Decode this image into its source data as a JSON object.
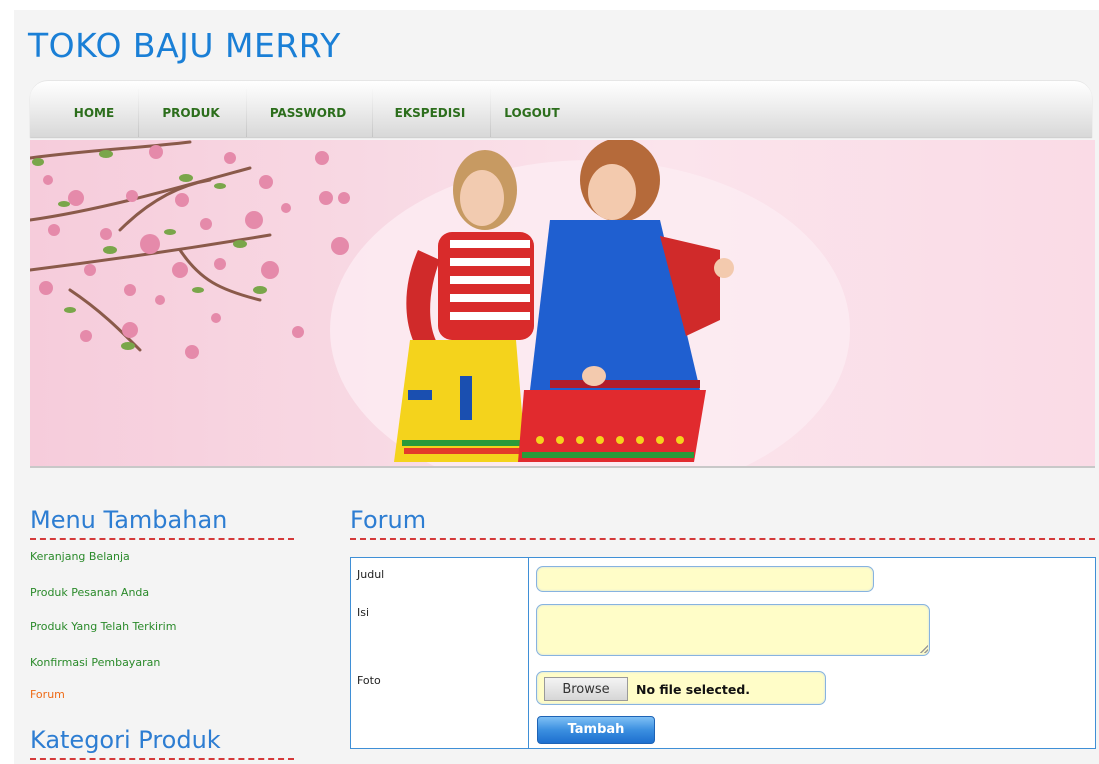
{
  "site": {
    "title": "TOKO BAJU MERRY"
  },
  "nav": {
    "items": [
      {
        "label": "HOME"
      },
      {
        "label": "PRODUK"
      },
      {
        "label": "PASSWORD"
      },
      {
        "label": "EKSPEDISI"
      },
      {
        "label": "LOGOUT"
      }
    ]
  },
  "sidebar": {
    "menu_title": "Menu Tambahan",
    "links": [
      {
        "label": "Keranjang Belanja"
      },
      {
        "label": "Produk Pesanan Anda"
      },
      {
        "label": "Produk Yang Telah Terkirim"
      },
      {
        "label": "Konfirmasi Pembayaran"
      },
      {
        "label": "Forum"
      }
    ],
    "category_title": "Kategori Produk"
  },
  "forum": {
    "title": "Forum",
    "labels": {
      "judul": "Judul",
      "isi": "Isi",
      "foto": "Foto"
    },
    "judul_value": "",
    "isi_value": "",
    "browse_label": "Browse",
    "file_status": "No file selected.",
    "submit_label": "Tambah"
  },
  "colors": {
    "title_blue": "#1a7fd6",
    "nav_green": "#2c6e1c",
    "link_green": "#2a8a2a",
    "active_orange": "#ee6a16",
    "dash_red": "#d43a3a",
    "field_yellow": "#fffdc8"
  }
}
